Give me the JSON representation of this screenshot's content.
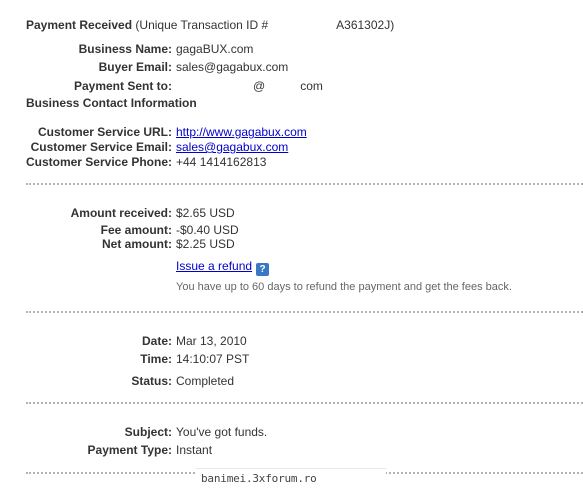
{
  "header": {
    "title": "Payment Received",
    "transaction_label": "(Unique Transaction ID #",
    "transaction_id_visible": "A361302J)"
  },
  "business": {
    "name_label": "Business Name:",
    "name_value": "gagaBUX.com",
    "email_label": "Buyer Email:",
    "email_value": "sales@gagabux.com",
    "sent_to_label": "Payment Sent to:",
    "sent_to_at": "@",
    "sent_to_domain": "com"
  },
  "contact": {
    "section_title": "Business Contact Information",
    "url_label": "Customer Service URL:",
    "url_value": "http://www.gagabux.com",
    "email_label": "Customer Service Email:",
    "email_value": "sales@gagabux.com",
    "phone_label": "Customer Service Phone:",
    "phone_value": "+44 1414162813"
  },
  "amounts": {
    "received_label": "Amount received:",
    "received_value": "$2.65 USD",
    "fee_label": "Fee amount:",
    "fee_value": "-$0.40 USD",
    "net_label": "Net amount:",
    "net_value": "$2.25 USD",
    "refund_link": "Issue a refund",
    "refund_help_icon": "?",
    "refund_note": "You have up to 60 days to refund the payment and get the fees back."
  },
  "details": {
    "date_label": "Date:",
    "date_value": "Mar 13, 2010",
    "time_label": "Time:",
    "time_value": "14:10:07 PST",
    "status_label": "Status:",
    "status_value": "Completed"
  },
  "message": {
    "subject_label": "Subject:",
    "subject_value": "You've got funds.",
    "type_label": "Payment Type:",
    "type_value": "Instant"
  },
  "footer": {
    "watermark": "banimei.3xforum.ro"
  },
  "colors": {
    "link": "#0000cc",
    "text": "#333333",
    "separator": "#b3b3b3",
    "help_icon": "#3a78c6"
  }
}
